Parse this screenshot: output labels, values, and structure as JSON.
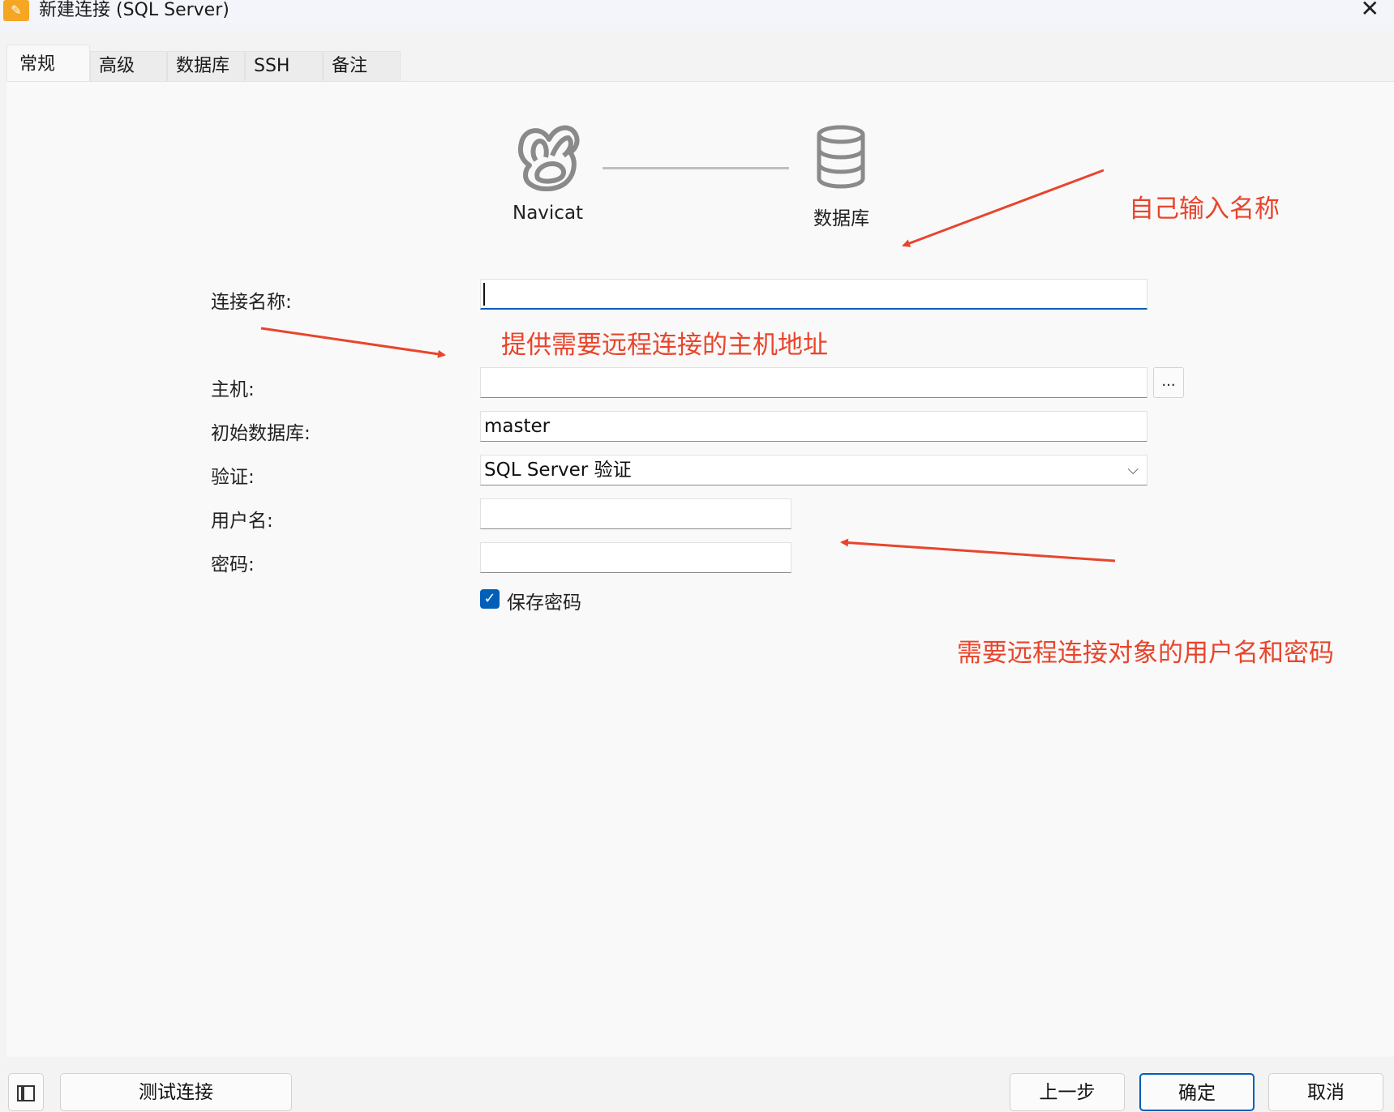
{
  "window": {
    "title": "新建连接 (SQL Server)",
    "app_icon": "navicat-app-icon",
    "close_glyph": "✕"
  },
  "tabs": [
    {
      "label": "常规",
      "active": true
    },
    {
      "label": "高级"
    },
    {
      "label": "数据库"
    },
    {
      "label": "SSH"
    },
    {
      "label": "备注"
    }
  ],
  "diagram": {
    "left_caption": "Navicat",
    "right_caption": "数据库"
  },
  "form": {
    "connection_name": {
      "label": "连接名称:",
      "value": ""
    },
    "host": {
      "label": "主机:",
      "value": "",
      "browse_label": "..."
    },
    "initial_db": {
      "label": "初始数据库:",
      "value": "master"
    },
    "auth": {
      "label": "验证:",
      "value": "SQL Server 验证"
    },
    "username": {
      "label": "用户名:",
      "value": ""
    },
    "password": {
      "label": "密码:",
      "value": ""
    },
    "save_password": {
      "label": "保存密码",
      "checked": true
    }
  },
  "annotations": {
    "name_hint": "自己输入名称",
    "host_hint": "提供需要远程连接的主机地址",
    "credentials_hint": "需要远程连接对象的用户名和密码",
    "color": "#e8452c"
  },
  "footer": {
    "test_label": "测试连接",
    "back_label": "上一步",
    "ok_label": "确定",
    "cancel_label": "取消"
  },
  "colors": {
    "accent": "#005fb8",
    "annotation": "#e8452c"
  }
}
